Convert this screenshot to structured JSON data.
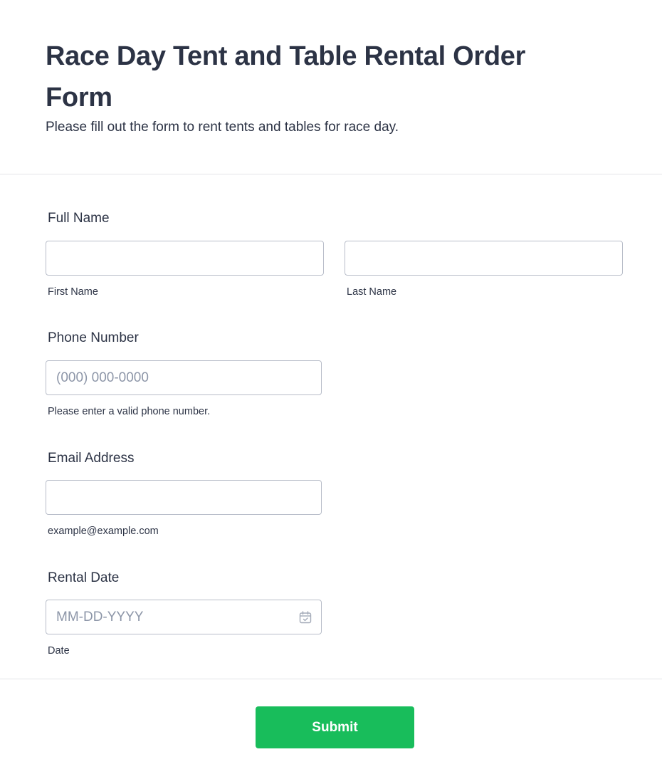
{
  "header": {
    "title": "Race Day Tent and Table Rental Order Form",
    "subtitle": "Please fill out the form to rent tents and tables for race day."
  },
  "full_name": {
    "label": "Full Name",
    "first": {
      "value": "",
      "sublabel": "First Name"
    },
    "last": {
      "value": "",
      "sublabel": "Last Name"
    }
  },
  "phone": {
    "label": "Phone Number",
    "placeholder": "(000) 000-0000",
    "value": "",
    "sublabel": "Please enter a valid phone number."
  },
  "email": {
    "label": "Email Address",
    "value": "",
    "sublabel": "example@example.com"
  },
  "rental_date": {
    "label": "Rental Date",
    "placeholder": "MM-DD-YYYY",
    "value": "",
    "sublabel": "Date",
    "icon": "calendar-icon"
  },
  "submit": {
    "label": "Submit"
  },
  "colors": {
    "submit_bg": "#18bd5b",
    "text": "#2c3345",
    "input_border": "#b8bdc9",
    "placeholder": "#8d96a8"
  }
}
